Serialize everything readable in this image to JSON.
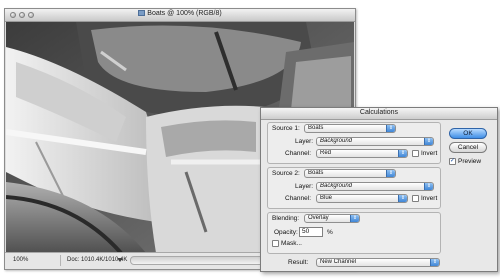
{
  "document_window": {
    "title": "Boats @ 100% (RGB/8)",
    "zoom": "100%",
    "doc_size": "Doc: 1010.4K/1010.4K"
  },
  "dialog": {
    "title": "Calculations",
    "source1": {
      "label": "Source 1:",
      "value": "Boats",
      "layer_label": "Layer:",
      "layer_value": "Background",
      "channel_label": "Channel:",
      "channel_value": "Red",
      "invert_label": "Invert",
      "invert_checked": false
    },
    "source2": {
      "label": "Source 2:",
      "value": "Boats",
      "layer_label": "Layer:",
      "layer_value": "Background",
      "channel_label": "Channel:",
      "channel_value": "Blue",
      "invert_label": "Invert",
      "invert_checked": false
    },
    "blending": {
      "label": "Blending:",
      "value": "Overlay",
      "opacity_label": "Opacity:",
      "opacity_value": "50",
      "opacity_unit": "%",
      "mask_label": "Mask...",
      "mask_checked": false
    },
    "result": {
      "label": "Result:",
      "value": "New Channel"
    },
    "buttons": {
      "ok": "OK",
      "cancel": "Cancel"
    },
    "preview": {
      "label": "Preview",
      "checked": true
    }
  },
  "colors": {
    "accent_blue": "#3f86d6",
    "ok_button": "#3f8ee6"
  }
}
